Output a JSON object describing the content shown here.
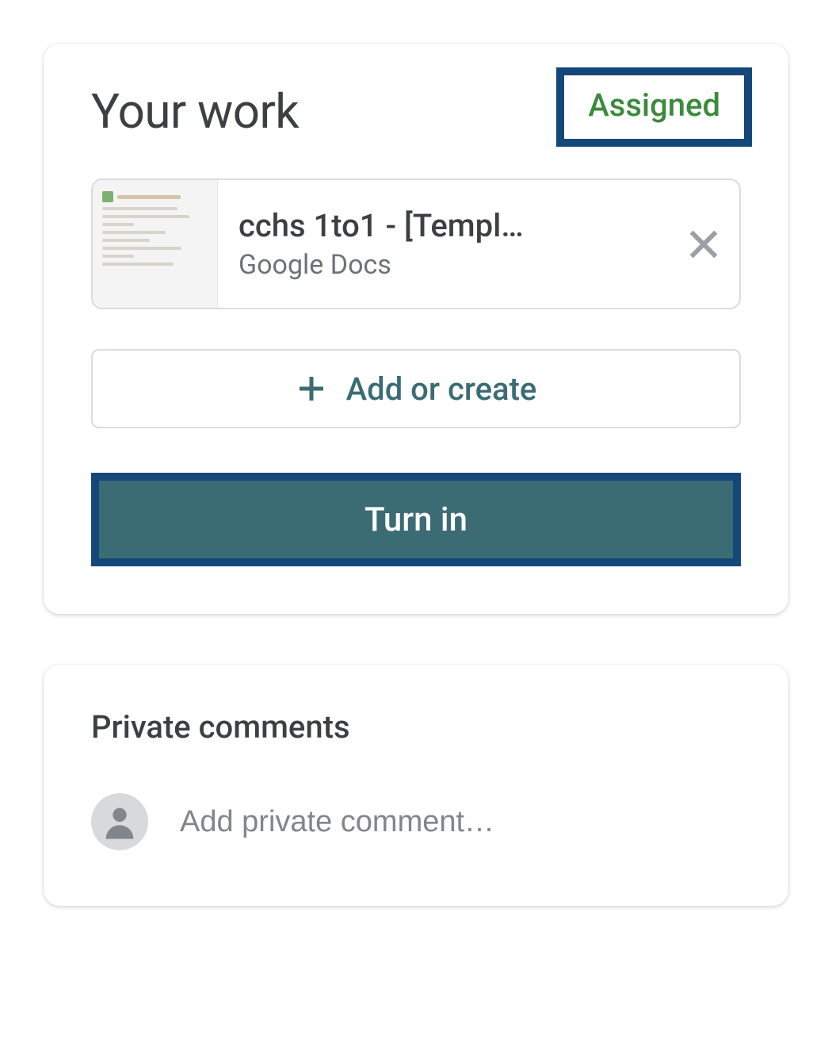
{
  "work": {
    "title": "Your work",
    "status": "Assigned",
    "attachment": {
      "title": "cchs 1to1 - [Templ…",
      "subtitle": "Google Docs"
    },
    "add_create_label": "Add or create",
    "turn_in_label": "Turn in"
  },
  "comments": {
    "title": "Private comments",
    "placeholder": "Add private comment…"
  }
}
